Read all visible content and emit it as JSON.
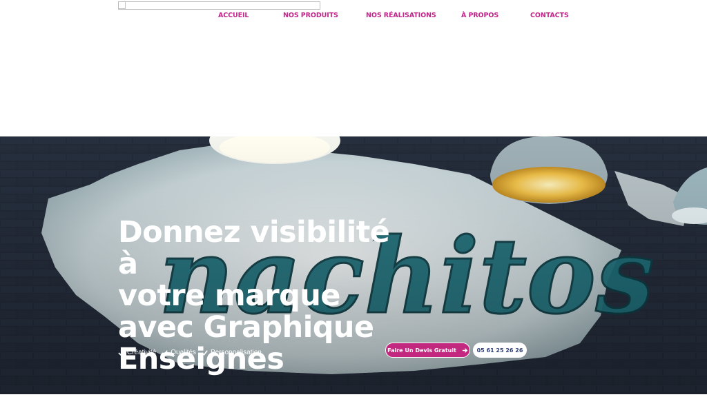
{
  "nav": {
    "items": [
      {
        "label": "ACCUEIL"
      },
      {
        "label": "NOS PRODUITS"
      },
      {
        "label": "NOS RÉALISATIONS"
      },
      {
        "label": "À PROPOS"
      },
      {
        "label": "CONTACTS"
      }
    ]
  },
  "hero": {
    "headline": [
      "Donnez visibilité à",
      "votre marque",
      "avec Graphique",
      "Enseignes"
    ],
    "features": [
      "Créativité",
      "Qualités",
      "Personnalisation"
    ],
    "cta_label": "Faire Un Devis Gratuit",
    "phone_label": "05 61 25 26 26",
    "sign_text": "nachitos"
  },
  "colors": {
    "accent": "#c1268b",
    "cta_background": "#c2287f",
    "phone_text": "#2c3e7a",
    "hero_background": "#1e2633"
  },
  "icons": {
    "logo": "broken-image-icon",
    "feature_check": "check-icon",
    "cta_arrow": "arrow-right-icon"
  }
}
